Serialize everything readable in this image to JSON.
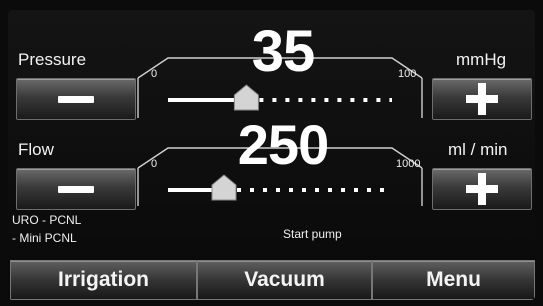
{
  "pressure": {
    "label": "Pressure",
    "value": "35",
    "unit": "mmHg",
    "min_label": "0",
    "max_label": "100",
    "level": 0.35
  },
  "flow": {
    "label": "Flow",
    "value": "250",
    "unit": "ml / min",
    "min_label": "0",
    "max_label": "1000",
    "level": 0.25
  },
  "status": {
    "mode_line1": "URO - PCNL",
    "mode_line2": "- Mini PCNL",
    "pump_text": "Start pump"
  },
  "tabs": [
    {
      "label": "Irrigation"
    },
    {
      "label": "Vacuum"
    },
    {
      "label": "Menu"
    }
  ],
  "icons": {
    "decrease": "minus-icon",
    "increase": "plus-icon",
    "slider_handle": "house-shaped-handle"
  }
}
